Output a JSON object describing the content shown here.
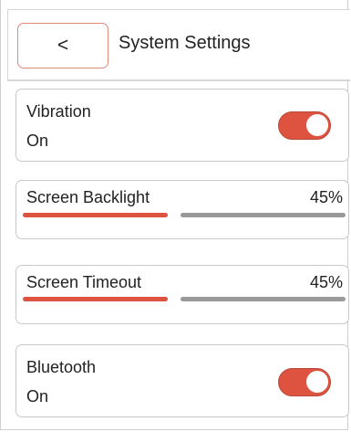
{
  "header": {
    "back_label": "<",
    "title": "System Settings"
  },
  "colors": {
    "accent": "#dd5340",
    "track_inactive": "#999999",
    "back_border": "#e08a7c"
  },
  "settings": {
    "vibration": {
      "label": "Vibration",
      "status": "On",
      "enabled": true
    },
    "backlight": {
      "label": "Screen Backlight",
      "value_text": "45%",
      "value": 45
    },
    "timeout": {
      "label": "Screen Timeout",
      "value_text": "45%",
      "value": 45
    },
    "bluetooth": {
      "label": "Bluetooth",
      "status": "On",
      "enabled": true
    }
  }
}
